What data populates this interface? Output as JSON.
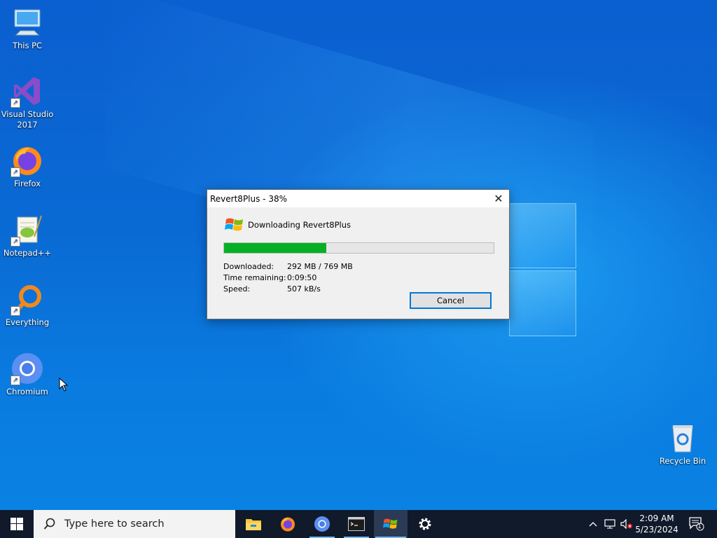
{
  "desktop": {
    "icons": [
      {
        "label": "This PC",
        "icon": "this-pc-icon"
      },
      {
        "label": "Visual Studio 2017",
        "icon": "visual-studio-icon"
      },
      {
        "label": "Firefox",
        "icon": "firefox-icon"
      },
      {
        "label": "Notepad++",
        "icon": "notepadpp-icon"
      },
      {
        "label": "Everything",
        "icon": "everything-icon"
      },
      {
        "label": "Chromium",
        "icon": "chromium-icon"
      },
      {
        "label": "Recycle Bin",
        "icon": "recycle-bin-icon"
      }
    ]
  },
  "dialog": {
    "title": "Revert8Plus - 38%",
    "close_glyph": "✕",
    "header": "Downloading Revert8Plus",
    "progress": 0.38,
    "rows": [
      {
        "key": "Downloaded:",
        "value": "292 MB / 769 MB"
      },
      {
        "key": "Time remaining:",
        "value": "0:09:50"
      },
      {
        "key": "Speed:",
        "value": "507 kB/s"
      }
    ],
    "cancel_label": "Cancel"
  },
  "taskbar": {
    "search_placeholder": "Type here to search",
    "apps": [
      "file-explorer-icon",
      "firefox-icon",
      "chromium-icon",
      "terminal-icon",
      "windows-flag-icon",
      "settings-icon"
    ],
    "clock": {
      "time": "2:09 AM",
      "date": "5/23/2024"
    },
    "notification_count": "1",
    "colors": {
      "bar": "#101a2b",
      "accent": "#76b9ed",
      "progress": "#06b025"
    }
  }
}
